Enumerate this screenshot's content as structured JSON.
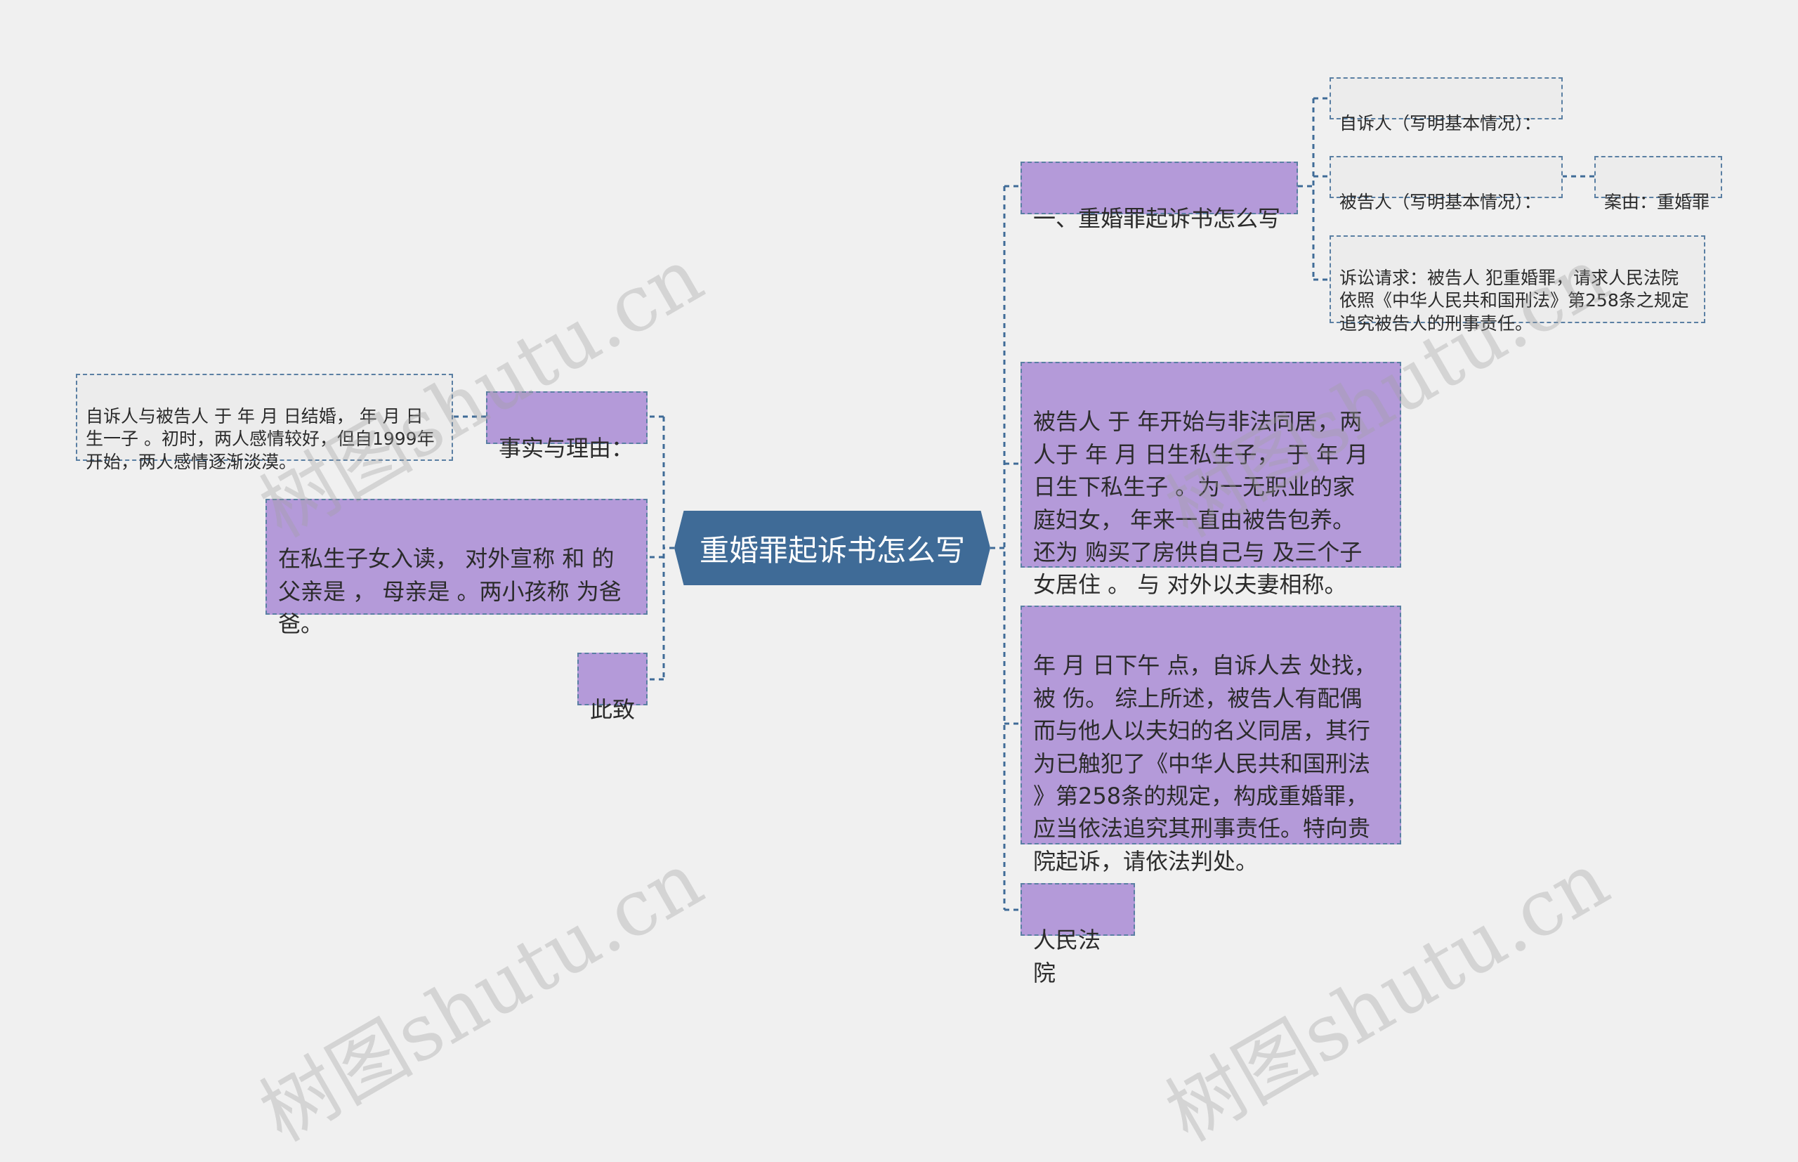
{
  "central": {
    "title": "重婚罪起诉书怎么写"
  },
  "right": {
    "section1": {
      "title": "一、重婚罪起诉书怎么写",
      "plaintiff": "自诉人（写明基本情况）：",
      "defendant": "被告人（写明基本情况）：",
      "case": "案由：重婚罪",
      "request": "诉讼请求：被告人 犯重婚罪，请求人民法院\n依照《中华人民共和国刑法》第258条之规定\n追究被告人的刑事责任。"
    },
    "cohabit": "被告人 于 年开始与非法同居，两\n人于 年 月 日生私生子，  于 年 月\n日生下私生子 。为一无职业的家\n庭妇女，  年来一直由被告包养。\n还为 购买了房供自己与 及三个子\n女居住 。 与 对外以夫妻相称。",
    "incident": "年 月 日下午 点，自诉人去 处找，\n被 伤。 综上所述，被告人有配偶\n而与他人以夫妇的名义同居，其行\n为已触犯了《中华人民共和国刑法\n》第258条的规定，构成重婚罪，\n应当依法追究其刑事责任。特向贵\n院起诉，请依法判处。",
    "court": "人民法院"
  },
  "left": {
    "facts_title": "事实与理由：",
    "facts_detail": "自诉人与被告人 于 年 月 日结婚，  年 月 日\n生一子 。初时，两人感情较好，但自1999年\n开始，两人感情逐渐淡漠。",
    "children": "在私生子女入读，  对外宣称 和 的\n父亲是 ， 母亲是 。两小孩称 为爸\n爸。",
    "closing": "此致"
  },
  "watermark": "树图shutu.cn",
  "colors": {
    "background": "#f0f0f0",
    "central": "#3f6b97",
    "branch": "#b49ad9",
    "leaf": "#ececec",
    "connector": "#3f6b97"
  }
}
